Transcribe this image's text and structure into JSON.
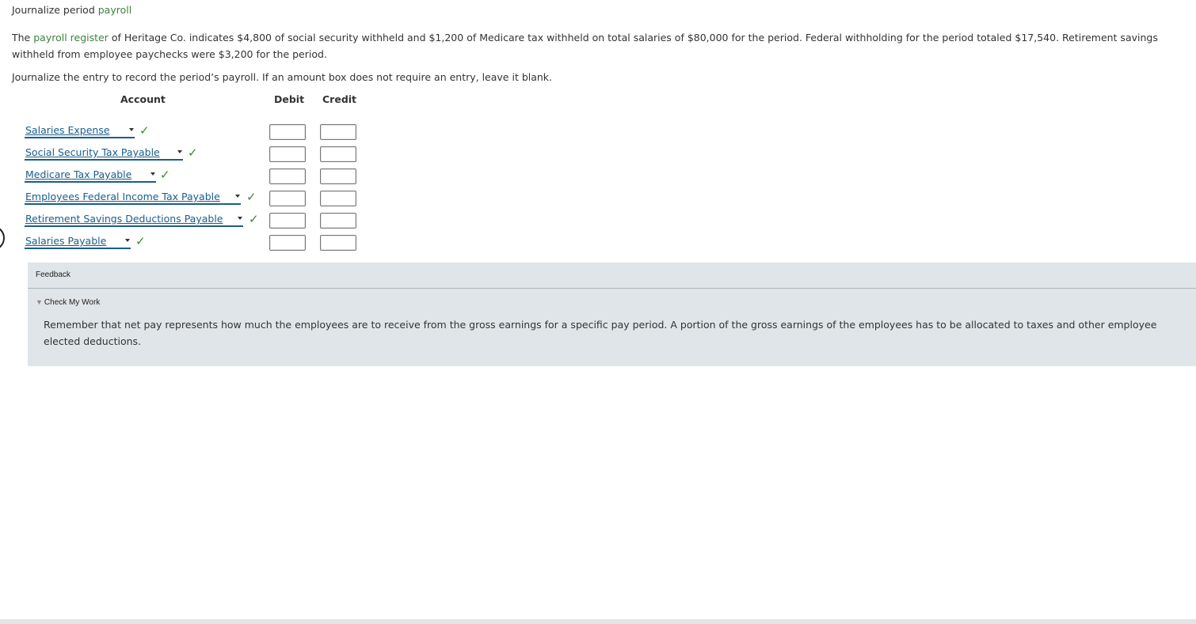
{
  "heading": {
    "prefix": "Journalize period ",
    "link": "payroll"
  },
  "problem": {
    "prefix": "The ",
    "link": "payroll register",
    "text": " of Heritage Co. indicates $4,800 of social security withheld and $1,200 of Medicare tax withheld on total salaries of $80,000 for the period. Federal withholding for the period totaled $17,540. Retirement savings withheld from employee paychecks were $3,200 for the period."
  },
  "instructions": "Journalize the entry to record the period’s payroll. If an amount box does not require an entry, leave it blank.",
  "columns": {
    "account": "Account",
    "debit": "Debit",
    "credit": "Credit"
  },
  "rows": [
    {
      "account": "Salaries Expense",
      "status": "✓"
    },
    {
      "account": "Social Security Tax Payable",
      "status": "✓"
    },
    {
      "account": "Medicare Tax Payable",
      "status": "✓"
    },
    {
      "account": "Employees Federal Income Tax Payable",
      "status": "✓"
    },
    {
      "account": "Retirement Savings Deductions Payable",
      "status": "✓"
    },
    {
      "account": "Salaries Payable",
      "status": "✓"
    }
  ],
  "feedback": {
    "title": "Feedback",
    "toggle_label": "Check My Work",
    "text": "Remember that net pay represents how much the employees are to receive from the gross earnings for a specific pay period. A portion of the gross earnings of the employees has to be allocated to taxes and other employee elected deductions."
  },
  "colors": {
    "link_green": "#3f7f3f",
    "select_blue": "#1a5d8c",
    "check_green": "#3a8a2e",
    "feedback_bg": "#dfe5e8"
  }
}
